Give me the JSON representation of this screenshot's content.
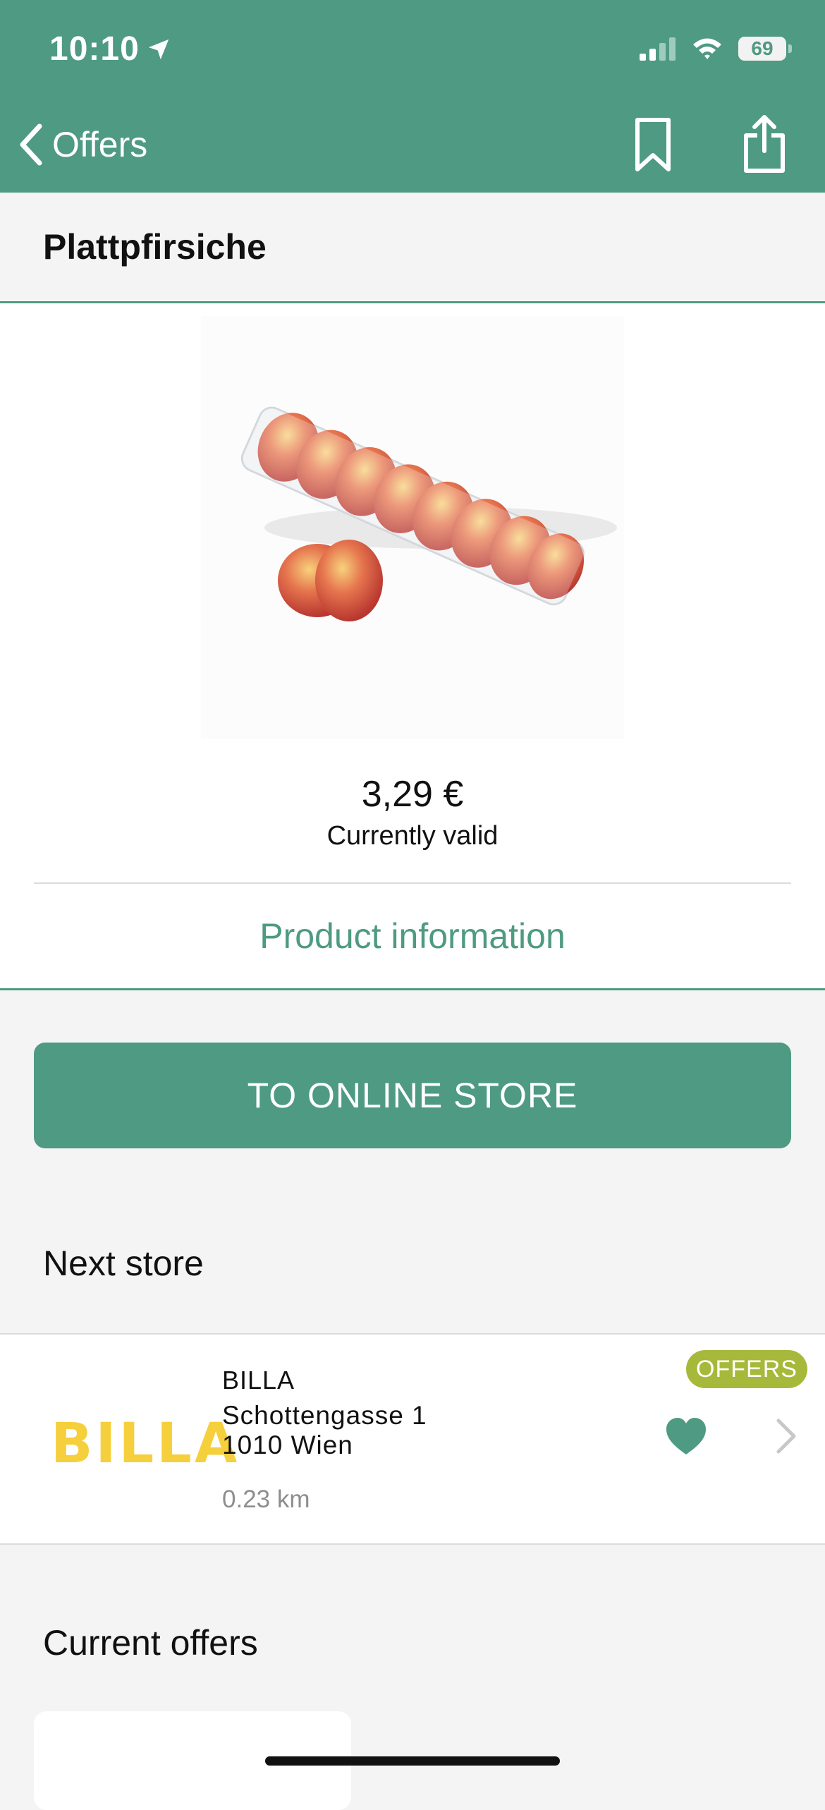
{
  "status_bar": {
    "time": "10:10",
    "battery": "69"
  },
  "nav": {
    "back_label": "Offers"
  },
  "product": {
    "title": "Plattpfirsiche",
    "price": "3,29 €",
    "validity": "Currently valid",
    "info_link": "Product information"
  },
  "cta": {
    "label": "TO ONLINE STORE"
  },
  "next_store": {
    "heading": "Next store",
    "logo_text": "BILLA",
    "name": "BILLA",
    "street": "Schottengasse 1",
    "city": "1010 Wien",
    "distance": "0.23 km",
    "badge": "OFFERS"
  },
  "current_offers": {
    "heading": "Current offers"
  },
  "colors": {
    "brand": "#4e9a82",
    "badge": "#a7b93a",
    "logo": "#f6cf3c"
  },
  "icons": {
    "location": "location-arrow-icon",
    "back": "chevron-left-icon",
    "bookmark": "bookmark-icon",
    "share": "share-icon",
    "favorite": "heart-icon",
    "open": "chevron-right-icon"
  }
}
